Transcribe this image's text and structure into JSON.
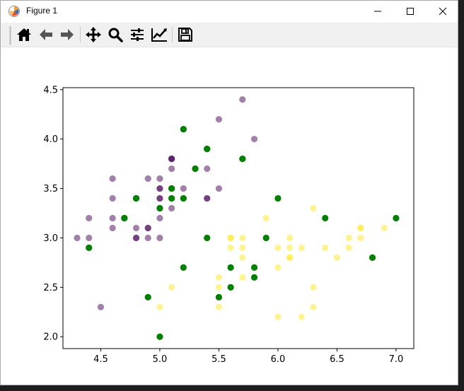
{
  "window": {
    "title": "Figure 1"
  },
  "toolbar": {
    "buttons": [
      {
        "name": "home-button",
        "icon": "home-icon"
      },
      {
        "name": "back-button",
        "icon": "arrow-left-icon"
      },
      {
        "name": "forward-button",
        "icon": "arrow-right-icon"
      },
      {
        "name": "pan-button",
        "icon": "move-icon"
      },
      {
        "name": "zoom-button",
        "icon": "magnifier-icon"
      },
      {
        "name": "subplots-button",
        "icon": "sliders-icon"
      },
      {
        "name": "axes-edit-button",
        "icon": "line-chart-icon"
      },
      {
        "name": "save-button",
        "icon": "floppy-disk-icon"
      }
    ]
  },
  "chart_data": {
    "type": "scatter",
    "title": "",
    "xlabel": "",
    "ylabel": "",
    "xlim": [
      4.18,
      7.15
    ],
    "ylim": [
      1.88,
      4.52
    ],
    "xticks": [
      4.5,
      5.0,
      5.5,
      6.0,
      6.5,
      7.0
    ],
    "xtick_labels": [
      "4.5",
      "5.0",
      "5.5",
      "6.0",
      "6.5",
      "7.0"
    ],
    "yticks": [
      2.0,
      2.5,
      3.0,
      3.5,
      4.0,
      4.5
    ],
    "ytick_labels": [
      "2.0",
      "2.5",
      "3.0",
      "3.5",
      "4.0",
      "4.5"
    ],
    "grid": false,
    "legend": "none",
    "series": [
      {
        "color": "#440154",
        "alpha": 0.5,
        "points": [
          [
            5.1,
            3.5
          ],
          [
            4.9,
            3.0
          ],
          [
            4.7,
            3.2
          ],
          [
            4.6,
            3.1
          ],
          [
            5.0,
            3.6
          ],
          [
            5.4,
            3.9
          ],
          [
            4.6,
            3.4
          ],
          [
            5.0,
            3.4
          ],
          [
            4.4,
            2.9
          ],
          [
            4.9,
            3.1
          ],
          [
            5.4,
            3.7
          ],
          [
            4.8,
            3.4
          ],
          [
            4.8,
            3.0
          ],
          [
            4.3,
            3.0
          ],
          [
            5.8,
            4.0
          ],
          [
            5.7,
            4.4
          ],
          [
            5.4,
            3.9
          ],
          [
            5.1,
            3.5
          ],
          [
            5.7,
            3.8
          ],
          [
            5.1,
            3.8
          ],
          [
            5.4,
            3.4
          ],
          [
            5.1,
            3.7
          ],
          [
            4.6,
            3.6
          ],
          [
            5.1,
            3.3
          ],
          [
            4.8,
            3.4
          ],
          [
            5.0,
            3.0
          ],
          [
            5.0,
            3.4
          ],
          [
            5.2,
            3.5
          ],
          [
            5.2,
            3.4
          ],
          [
            4.7,
            3.2
          ],
          [
            4.8,
            3.1
          ],
          [
            5.4,
            3.4
          ],
          [
            5.2,
            4.1
          ],
          [
            5.5,
            4.2
          ],
          [
            4.9,
            3.1
          ],
          [
            5.0,
            3.2
          ],
          [
            5.5,
            3.5
          ],
          [
            4.9,
            3.6
          ],
          [
            4.4,
            3.0
          ],
          [
            5.1,
            3.4
          ],
          [
            5.0,
            3.5
          ],
          [
            4.5,
            2.3
          ],
          [
            4.4,
            3.2
          ],
          [
            5.0,
            3.5
          ],
          [
            5.1,
            3.8
          ],
          [
            4.8,
            3.0
          ],
          [
            5.1,
            3.8
          ],
          [
            4.6,
            3.2
          ],
          [
            5.3,
            3.7
          ],
          [
            5.0,
            3.3
          ]
        ]
      },
      {
        "color": "#fde725",
        "alpha": 0.5,
        "points": [
          [
            5.5,
            2.3
          ],
          [
            6.5,
            2.8
          ],
          [
            6.3,
            3.3
          ],
          [
            4.9,
            2.4
          ],
          [
            6.6,
            2.9
          ],
          [
            5.2,
            2.7
          ],
          [
            5.0,
            2.0
          ],
          [
            5.9,
            3.0
          ],
          [
            6.0,
            2.2
          ],
          [
            6.1,
            2.9
          ],
          [
            5.6,
            2.9
          ],
          [
            6.7,
            3.1
          ],
          [
            5.6,
            3.0
          ],
          [
            5.8,
            2.7
          ],
          [
            6.2,
            2.2
          ],
          [
            5.6,
            2.5
          ],
          [
            5.9,
            3.2
          ],
          [
            6.1,
            2.8
          ],
          [
            6.3,
            2.5
          ],
          [
            6.1,
            2.8
          ],
          [
            6.4,
            2.9
          ],
          [
            6.6,
            3.0
          ],
          [
            6.8,
            2.8
          ],
          [
            6.7,
            3.0
          ],
          [
            6.0,
            2.9
          ],
          [
            5.7,
            2.6
          ],
          [
            5.5,
            2.4
          ],
          [
            5.5,
            2.4
          ],
          [
            5.8,
            2.7
          ],
          [
            6.0,
            2.7
          ],
          [
            5.4,
            3.0
          ],
          [
            6.0,
            3.4
          ],
          [
            6.7,
            3.1
          ],
          [
            6.3,
            2.3
          ],
          [
            5.6,
            3.0
          ],
          [
            5.5,
            2.5
          ],
          [
            5.5,
            2.6
          ],
          [
            6.1,
            3.0
          ],
          [
            5.8,
            2.6
          ],
          [
            5.0,
            2.3
          ],
          [
            5.6,
            2.7
          ],
          [
            5.7,
            3.0
          ],
          [
            5.7,
            2.9
          ],
          [
            6.2,
            2.9
          ],
          [
            5.1,
            2.5
          ],
          [
            5.7,
            2.8
          ],
          [
            6.9,
            3.1
          ]
        ]
      },
      {
        "color": "#008000",
        "alpha": 1.0,
        "points": [
          [
            5.2,
            4.1
          ],
          [
            5.4,
            3.9
          ],
          [
            5.3,
            3.7
          ],
          [
            5.7,
            3.8
          ],
          [
            4.8,
            3.4
          ],
          [
            5.1,
            3.5
          ],
          [
            5.1,
            3.4
          ],
          [
            5.2,
            3.4
          ],
          [
            5.0,
            3.3
          ],
          [
            4.7,
            3.2
          ],
          [
            4.4,
            2.9
          ],
          [
            5.4,
            3.0
          ],
          [
            6.0,
            3.4
          ],
          [
            6.4,
            3.2
          ],
          [
            7.0,
            3.2
          ],
          [
            5.9,
            3.0
          ],
          [
            5.2,
            2.7
          ],
          [
            5.6,
            2.7
          ],
          [
            5.8,
            2.7
          ],
          [
            5.8,
            2.6
          ],
          [
            6.8,
            2.8
          ],
          [
            4.9,
            2.4
          ],
          [
            5.5,
            2.4
          ],
          [
            5.6,
            2.5
          ],
          [
            5.0,
            2.0
          ]
        ]
      }
    ]
  }
}
